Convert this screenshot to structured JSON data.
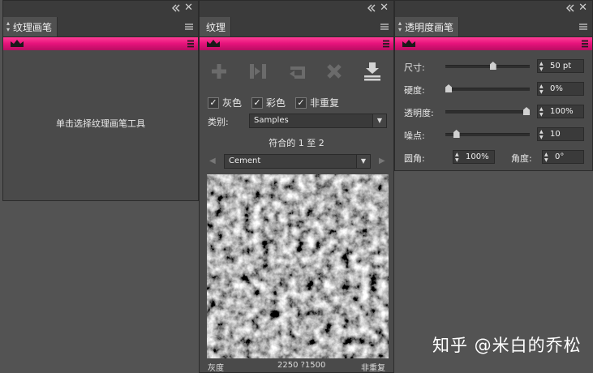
{
  "panels": {
    "texture_brush": {
      "tab_label": "纹理画笔",
      "hint": "单击选择纹理画笔工具"
    },
    "texture": {
      "tab_label": "纹理",
      "checkboxes": [
        {
          "label": "灰色",
          "checked": true
        },
        {
          "label": "彩色",
          "checked": true
        },
        {
          "label": "非重复",
          "checked": true
        }
      ],
      "category_label": "类别:",
      "category_value": "Samples",
      "match_count": "符合的 1 至 2",
      "texture_name": "Cement",
      "footer": {
        "mode": "灰度",
        "size": "2250 ?1500",
        "repeat": "非重复"
      }
    },
    "transparency_brush": {
      "tab_label": "透明度画笔",
      "sliders": [
        {
          "label": "尺寸:",
          "value": "50 pt",
          "level": 0.57
        },
        {
          "label": "硬度:",
          "value": "0%",
          "level": 0.0
        },
        {
          "label": "透明度:",
          "value": "100%",
          "level": 1.0
        },
        {
          "label": "噪点:",
          "value": "10",
          "level": 0.1
        }
      ],
      "roundness_label": "圆角:",
      "roundness_value": "100%",
      "angle_label": "角度:",
      "angle_value": "0°"
    }
  },
  "watermark": "知乎 @米白的乔松",
  "colors": {
    "accent": "#e5127a",
    "panel": "#4a4a4a",
    "background": "#535353"
  }
}
